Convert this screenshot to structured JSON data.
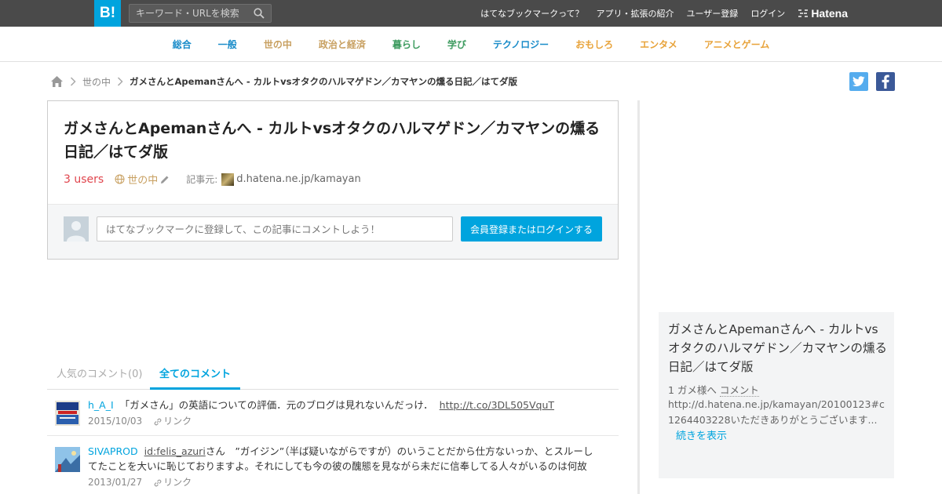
{
  "topbar": {
    "logo": "B!",
    "search_placeholder": "キーワード・URLを検索",
    "nav": [
      "はてなブックマークって？",
      "アプリ・拡張の紹介",
      "ユーザー登録",
      "ログイン"
    ],
    "brand": "Hatena",
    "bg_color": "#4a4a4a",
    "accent": "#00a4de"
  },
  "categories": [
    {
      "label": "総合",
      "color": "#1a8cc9"
    },
    {
      "label": "一般",
      "color": "#1a8cc9"
    },
    {
      "label": "世の中",
      "color": "#c8a061"
    },
    {
      "label": "政治と経済",
      "color": "#c8a061"
    },
    {
      "label": "暮らし",
      "color": "#3d9b5f"
    },
    {
      "label": "学び",
      "color": "#3d9b5f"
    },
    {
      "label": "テクノロジー",
      "color": "#1a8cc9"
    },
    {
      "label": "おもしろ",
      "color": "#e8a33a"
    },
    {
      "label": "エンタメ",
      "color": "#e8a33a"
    },
    {
      "label": "アニメとゲーム",
      "color": "#e8a33a"
    }
  ],
  "breadcrumb": {
    "category": "世の中",
    "current": "ガメさんとApemanさんへ - カルトvsオタクのハルマゲドン／カマヤンの燻る日記／はてダ版"
  },
  "entry": {
    "title": "ガメさんとApemanさんへ - カルトvsオタクのハルマゲドン／カマヤンの燻る日記／はてダ版",
    "users": "3 users",
    "category": "世の中",
    "source_label": "記事元:",
    "source": "d.hatena.ne.jp/kamayan",
    "comment_placeholder": "はてなブックマークに登録して、この記事にコメントしよう！",
    "login_button": "会員登録またはログインする"
  },
  "tabs": {
    "popular": "人気のコメント(0)",
    "all": "全てのコメント"
  },
  "comments": [
    {
      "user": "h_A_I",
      "text": "「ガメさん」の英語についての評価．元のブログは見れないんだっけ．",
      "link": "http://t.co/3DL505VquT",
      "date": "2015/10/03",
      "link_label": "リンク"
    },
    {
      "user": "SIVAPROD",
      "mention": "id:felis_azuri",
      "text": "さん　”ガイジン”（半ば疑いながらですが）のいうことだから仕方ないっか、とスルーしてたことを大いに恥じておりますよ。それにしても今の彼の醜態を見ながら未だに信奉してる人々がいるのは何故",
      "date": "2013/01/27",
      "link_label": "リンク"
    }
  ],
  "sidebar": {
    "title": "ガメさんとApemanさんへ - カルトvsオタクのハルマゲドン／カマヤンの燻る日記／はてダ版",
    "meta_prefix": "1 ガメ様へ",
    "meta_comment": "コメント",
    "text": "http://d.hatena.ne.jp/kamayan/20100123#c1264403228いただきありがとうございます...",
    "more": "続きを表示"
  }
}
